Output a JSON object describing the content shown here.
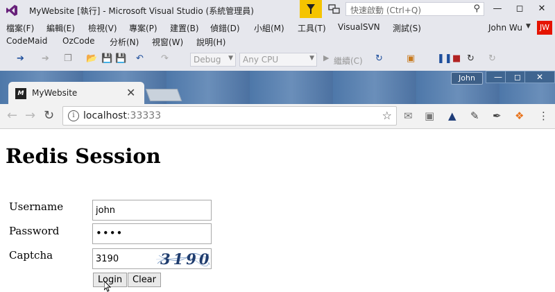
{
  "vs": {
    "title": "MyWebsite [執行] - Microsoft Visual Studio  (系統管理員)",
    "quick_launch_placeholder": "快速啟動 (Ctrl+Q)",
    "menu_row1": [
      "檔案(F)",
      "編輯(E)",
      "檢視(V)",
      "專案(P)",
      "建置(B)",
      "偵錯(D)",
      "小組(M)",
      "工具(T)",
      "VisualSVN",
      "測試(S)"
    ],
    "menu_row2": [
      "CodeMaid",
      "OzCode",
      "分析(N)",
      "視窗(W)",
      "說明(H)"
    ],
    "user_name": "John Wu",
    "user_initials": "JW",
    "config": "Debug",
    "platform": "Any CPU",
    "continue_label": "繼續(C)",
    "accent": "#f5c400"
  },
  "chrome": {
    "profile": "John",
    "tab_title": "MyWebsite",
    "url_host": "localhost",
    "url_port": ":33333"
  },
  "page": {
    "title": "Redis Session",
    "username_label": "Username",
    "password_label": "Password",
    "captcha_label": "Captcha",
    "username_value": "john",
    "password_value": "••••",
    "captcha_value": "3190",
    "captcha_image_text": "3190",
    "login_label": "Login",
    "clear_label": "Clear"
  }
}
